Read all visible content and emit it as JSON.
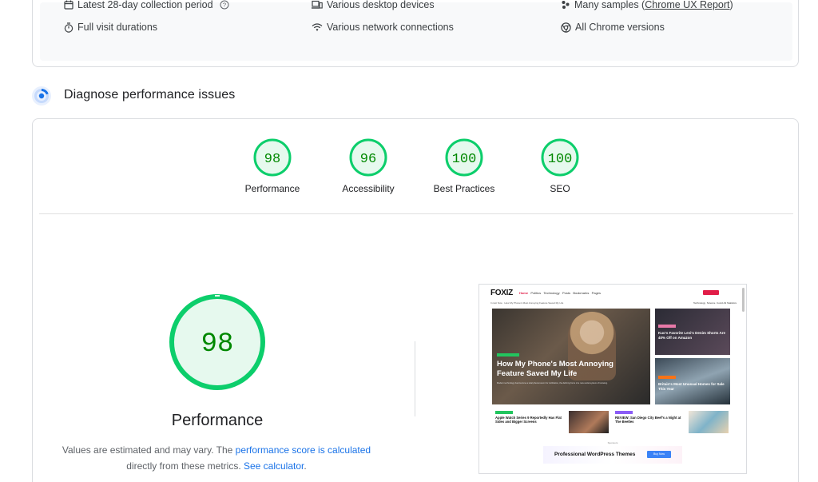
{
  "field_data": {
    "items": [
      {
        "label": "Latest 28-day collection period",
        "icon": "calendar-icon"
      },
      {
        "label": "Various desktop devices",
        "icon": "devices-icon"
      },
      {
        "label": "Many samples (",
        "link": "Chrome UX Report",
        "suffix": ")",
        "icon": "samples-icon"
      },
      {
        "label": "Full visit durations",
        "icon": "timer-icon"
      },
      {
        "label": "Various network connections",
        "icon": "wifi-icon"
      },
      {
        "label": "All Chrome versions",
        "icon": "chrome-icon"
      }
    ]
  },
  "diagnose": {
    "title": "Diagnose performance issues"
  },
  "categories": [
    {
      "label": "Performance",
      "score": 98
    },
    {
      "label": "Accessibility",
      "score": 96
    },
    {
      "label": "Best Practices",
      "score": 100
    },
    {
      "label": "SEO",
      "score": 100
    }
  ],
  "performance": {
    "score": 98,
    "title": "Performance",
    "desc_prefix": "Values are estimated and may vary. The ",
    "desc_link": "performance score is calculated",
    "desc_middle": "directly from these metrics. ",
    "desc_link2": "See calculator",
    "desc_suffix": "."
  },
  "colors": {
    "pass": "#0cce6b",
    "pass_text": "#008800",
    "pass_fill": "#e6f9ee",
    "link": "#1a73e8"
  },
  "screenshot": {
    "logo": "FOXIZ",
    "menu": [
      "Home",
      "Politics",
      "Technology",
      "Posts",
      "Bookmarks",
      "Pages"
    ],
    "breadcrumb": "In Hot Now",
    "headline_small": "How My Phone's Most Annoying Feature Saved My Life",
    "tags": [
      "Technology",
      "Science",
      "Covid-19 Statistics"
    ],
    "hero_tag": "TECHNOLOGY",
    "hero_title": "How My Phone's Most Annoying Feature Saved My Life",
    "hero_excerpt": "Modern technology has become a total phenomenon for civilization, the defining force of a new social system of knowing.",
    "side1_title": "Kuo's Favorite Levi's Denim Shorts Are 40% Off on Amazon",
    "side2_title": "Britain's Most Unusual Homes for Sale This Year",
    "card1_title": "Apple Watch Series 9 Reportedly Has Flat Sides and Bigger Screens",
    "card2_title": "REVIEW: San Diego City Beef's a Night at The Beetles",
    "sponsored": "Sponsors",
    "ad_text": "Professional WordPress Themes",
    "ad_button": "Buy Now"
  }
}
